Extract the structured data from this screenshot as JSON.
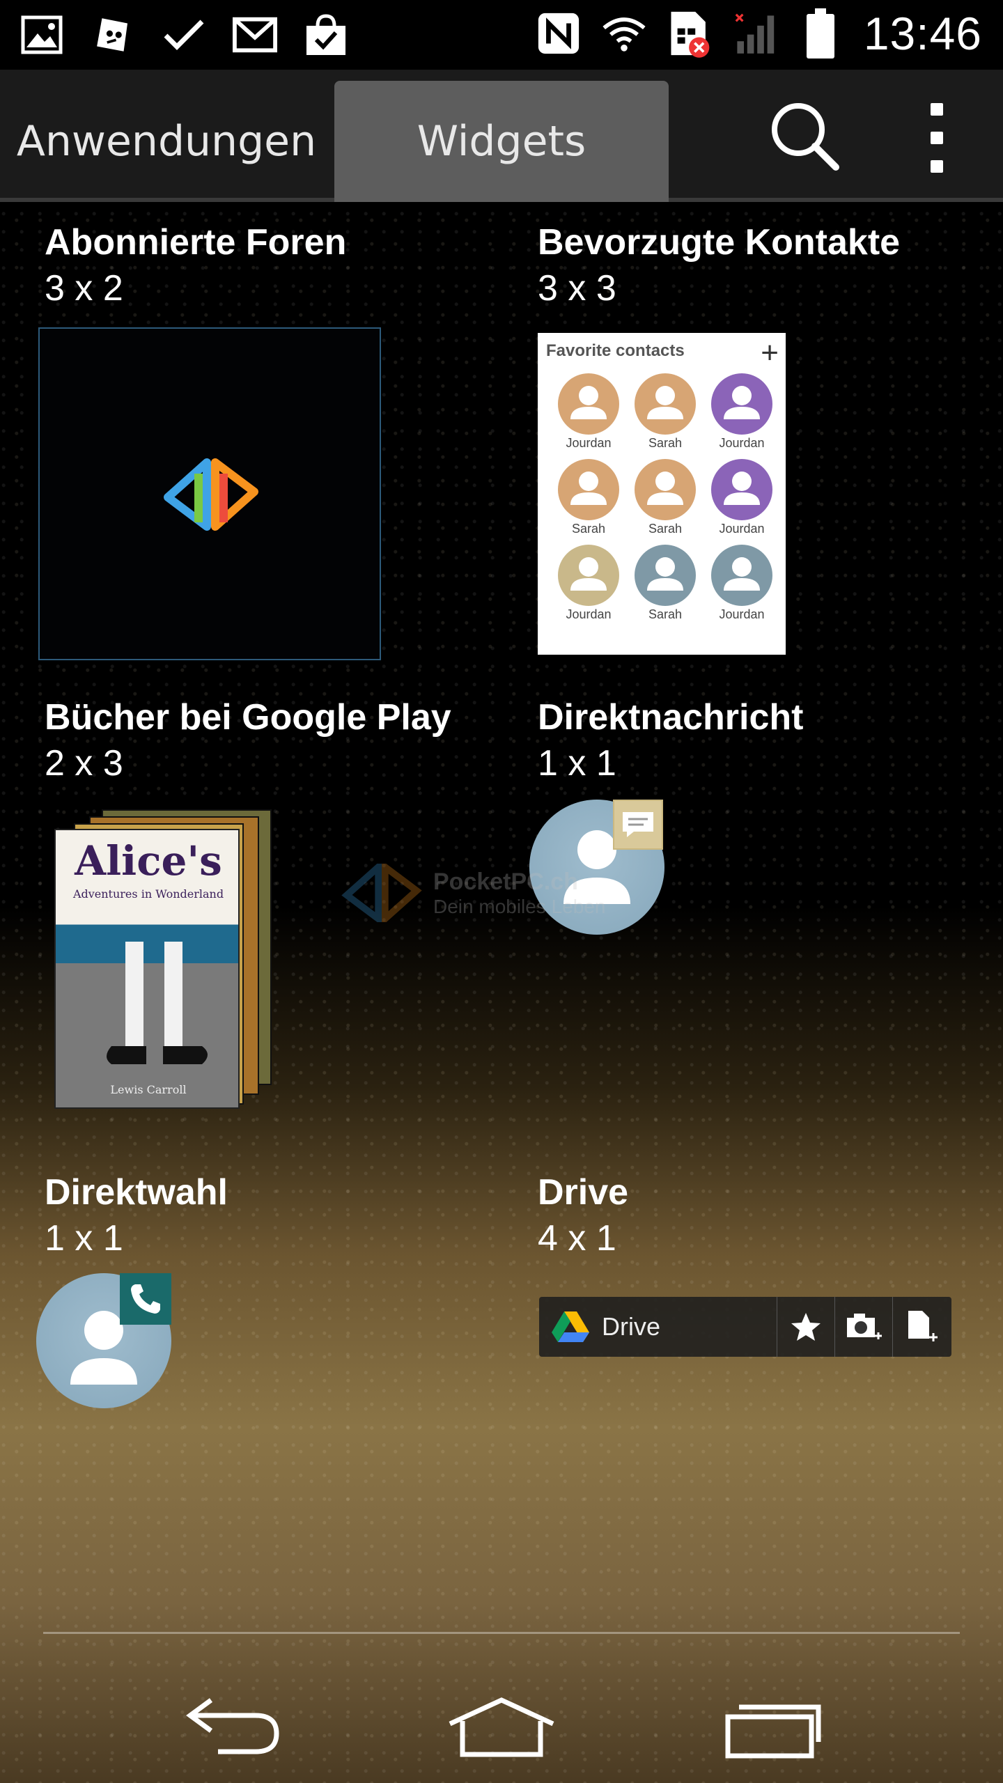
{
  "status_bar": {
    "time": "13:46",
    "left_icons": [
      "gallery-icon",
      "unknown-app-icon",
      "check-icon",
      "gmail-icon",
      "shopping-bag-check-icon"
    ],
    "right_icons": [
      "nfc-icon",
      "wifi-icon",
      "sim-error-icon",
      "signal-no-service-icon",
      "battery-icon"
    ]
  },
  "action_bar": {
    "tabs": [
      {
        "label": "Anwendungen",
        "selected": false
      },
      {
        "label": "Widgets",
        "selected": true
      }
    ],
    "search_icon": "search-icon",
    "overflow_icon": "more-vert-icon"
  },
  "widgets": [
    {
      "title": "Abonnierte Foren",
      "size": "3 x 2"
    },
    {
      "title": "Bevorzugte Kontakte",
      "size": "3 x 3"
    },
    {
      "title": "Bücher bei Google Play",
      "size": "2 x 3"
    },
    {
      "title": "Direktnachricht",
      "size": "1 x 1"
    },
    {
      "title": "Direktwahl",
      "size": "1 x 1"
    },
    {
      "title": "Drive",
      "size": "4 x 1"
    }
  ],
  "favorite_contacts": {
    "header": "Favorite contacts",
    "add_symbol": "+",
    "contacts": [
      {
        "name": "Jourdan",
        "color": "#d7a574"
      },
      {
        "name": "Sarah",
        "color": "#d7a574"
      },
      {
        "name": "Jourdan",
        "color": "#8b64b8"
      },
      {
        "name": "Sarah",
        "color": "#d7a574"
      },
      {
        "name": "Sarah",
        "color": "#d7a574"
      },
      {
        "name": "Jourdan",
        "color": "#8b64b8"
      },
      {
        "name": "Jourdan",
        "color": "#c9b88a"
      },
      {
        "name": "Sarah",
        "color": "#7f99a6"
      },
      {
        "name": "Jourdan",
        "color": "#7f99a6"
      }
    ]
  },
  "book": {
    "title": "Alice's",
    "subtitle": "Adventures in Wonderland",
    "author": "Lewis Carroll"
  },
  "drive_widget": {
    "label": "Drive",
    "buttons": [
      "star-icon",
      "camera-add-icon",
      "new-document-icon"
    ]
  },
  "watermark": {
    "line1": "PocketPC.ch",
    "line2": "Dein mobiles Leben"
  },
  "nav_bar": {
    "buttons": [
      "back-icon",
      "home-icon",
      "recents-icon"
    ]
  },
  "colors": {
    "action_bar_bg": "#1b1b1b",
    "selected_tab_bg": "#5d5d5d",
    "contact_bubble": "#9fbccd"
  }
}
